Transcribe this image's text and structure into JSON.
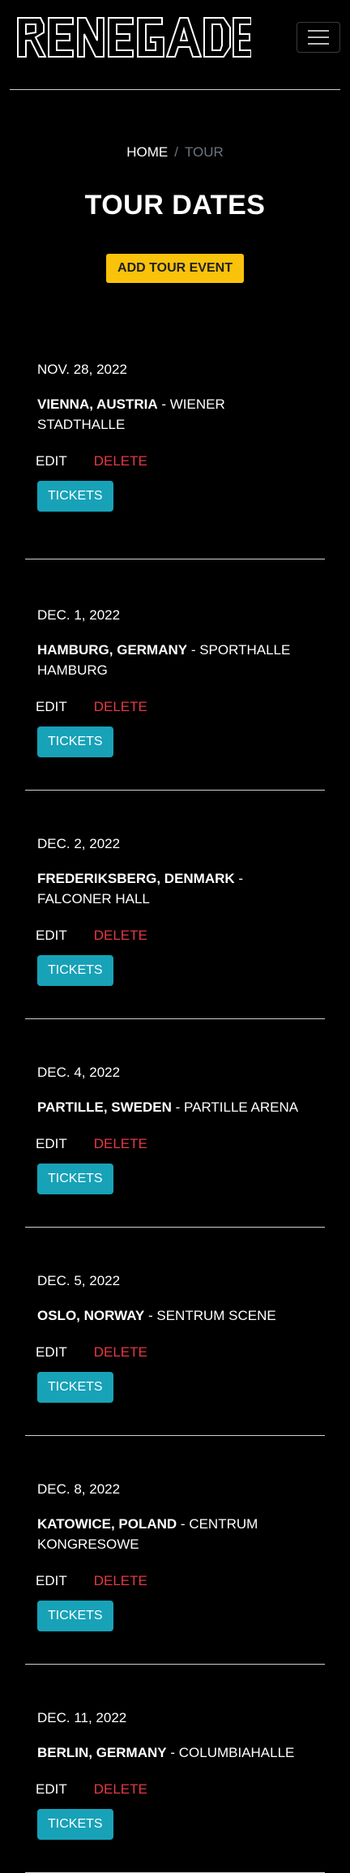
{
  "brand": {
    "logo_text": "RENEGADE"
  },
  "breadcrumb": {
    "home": "HOME",
    "separator": "/",
    "current": "TOUR"
  },
  "page": {
    "title": "TOUR DATES",
    "add_button": "ADD TOUR EVENT"
  },
  "colors": {
    "accent_yellow": "#f9c20b",
    "tickets_teal": "#17a2b8",
    "delete_red": "#e63946",
    "background": "#000000"
  },
  "events": [
    {
      "date": "NOV. 28, 2022",
      "city": "VIENNA, AUSTRIA",
      "venue": "WIENER STADTHALLE",
      "edit": "EDIT",
      "delete": "DELETE",
      "tickets": "TICKETS"
    },
    {
      "date": "DEC. 1, 2022",
      "city": "HAMBURG, GERMANY",
      "venue": "SPORTHALLE HAMBURG",
      "edit": "EDIT",
      "delete": "DELETE",
      "tickets": "TICKETS"
    },
    {
      "date": "DEC. 2, 2022",
      "city": "FREDERIKSBERG, DENMARK",
      "venue": "FALCONER HALL",
      "edit": "EDIT",
      "delete": "DELETE",
      "tickets": "TICKETS"
    },
    {
      "date": "DEC. 4, 2022",
      "city": "PARTILLE, SWEDEN",
      "venue": "PARTILLE ARENA",
      "edit": "EDIT",
      "delete": "DELETE",
      "tickets": "TICKETS"
    },
    {
      "date": "DEC. 5, 2022",
      "city": "OSLO, NORWAY",
      "venue": "SENTRUM SCENE",
      "edit": "EDIT",
      "delete": "DELETE",
      "tickets": "TICKETS"
    },
    {
      "date": "DEC. 8, 2022",
      "city": "KATOWICE, POLAND",
      "venue": "CENTRUM KONGRESOWE",
      "edit": "EDIT",
      "delete": "DELETE",
      "tickets": "TICKETS"
    },
    {
      "date": "DEC. 11, 2022",
      "city": "BERLIN, GERMANY",
      "venue": "COLUMBIAHALLE",
      "edit": "EDIT",
      "delete": "DELETE",
      "tickets": "TICKETS"
    }
  ]
}
